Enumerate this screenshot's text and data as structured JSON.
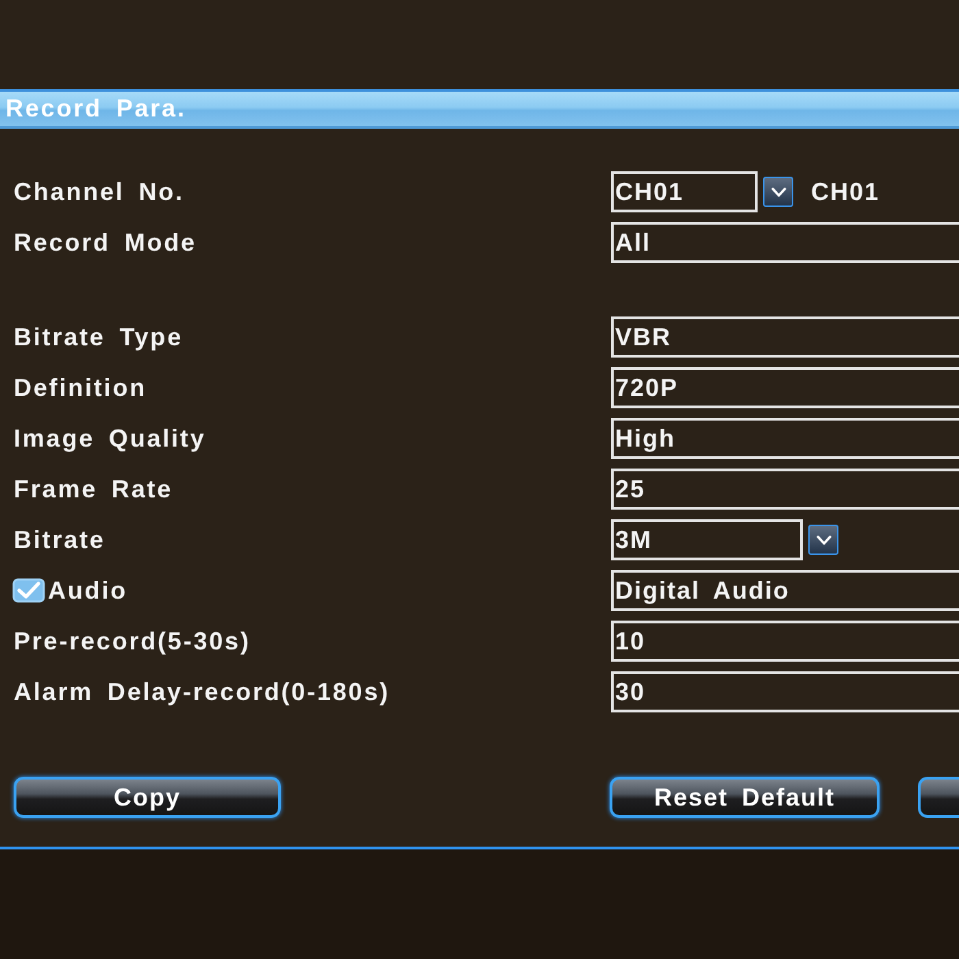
{
  "window": {
    "title": "Record Para."
  },
  "sections": [
    {
      "rows": [
        {
          "label": "Channel No.",
          "kind": "select",
          "value": "CH01",
          "note": "CH01"
        },
        {
          "label": "Record Mode",
          "kind": "field",
          "value": "All"
        }
      ]
    },
    {
      "rows": [
        {
          "label": "Bitrate Type",
          "kind": "field",
          "value": "VBR"
        },
        {
          "label": "Definition",
          "kind": "field",
          "value": "720P"
        },
        {
          "label": "Image Quality",
          "kind": "field",
          "value": "High"
        },
        {
          "label": "Frame Rate",
          "kind": "field",
          "value": "25"
        },
        {
          "label": "Bitrate",
          "kind": "select",
          "value": "3M"
        },
        {
          "label": "Audio",
          "checked": true,
          "kind": "field",
          "value": "Digital Audio"
        },
        {
          "label": "Pre-record(5-30s)",
          "kind": "field",
          "value": "10"
        },
        {
          "label": "Alarm Delay-record(0-180s)",
          "kind": "field",
          "value": "30"
        }
      ]
    }
  ],
  "buttons": [
    {
      "label": "Copy"
    },
    {
      "label": "Reset Default"
    }
  ]
}
